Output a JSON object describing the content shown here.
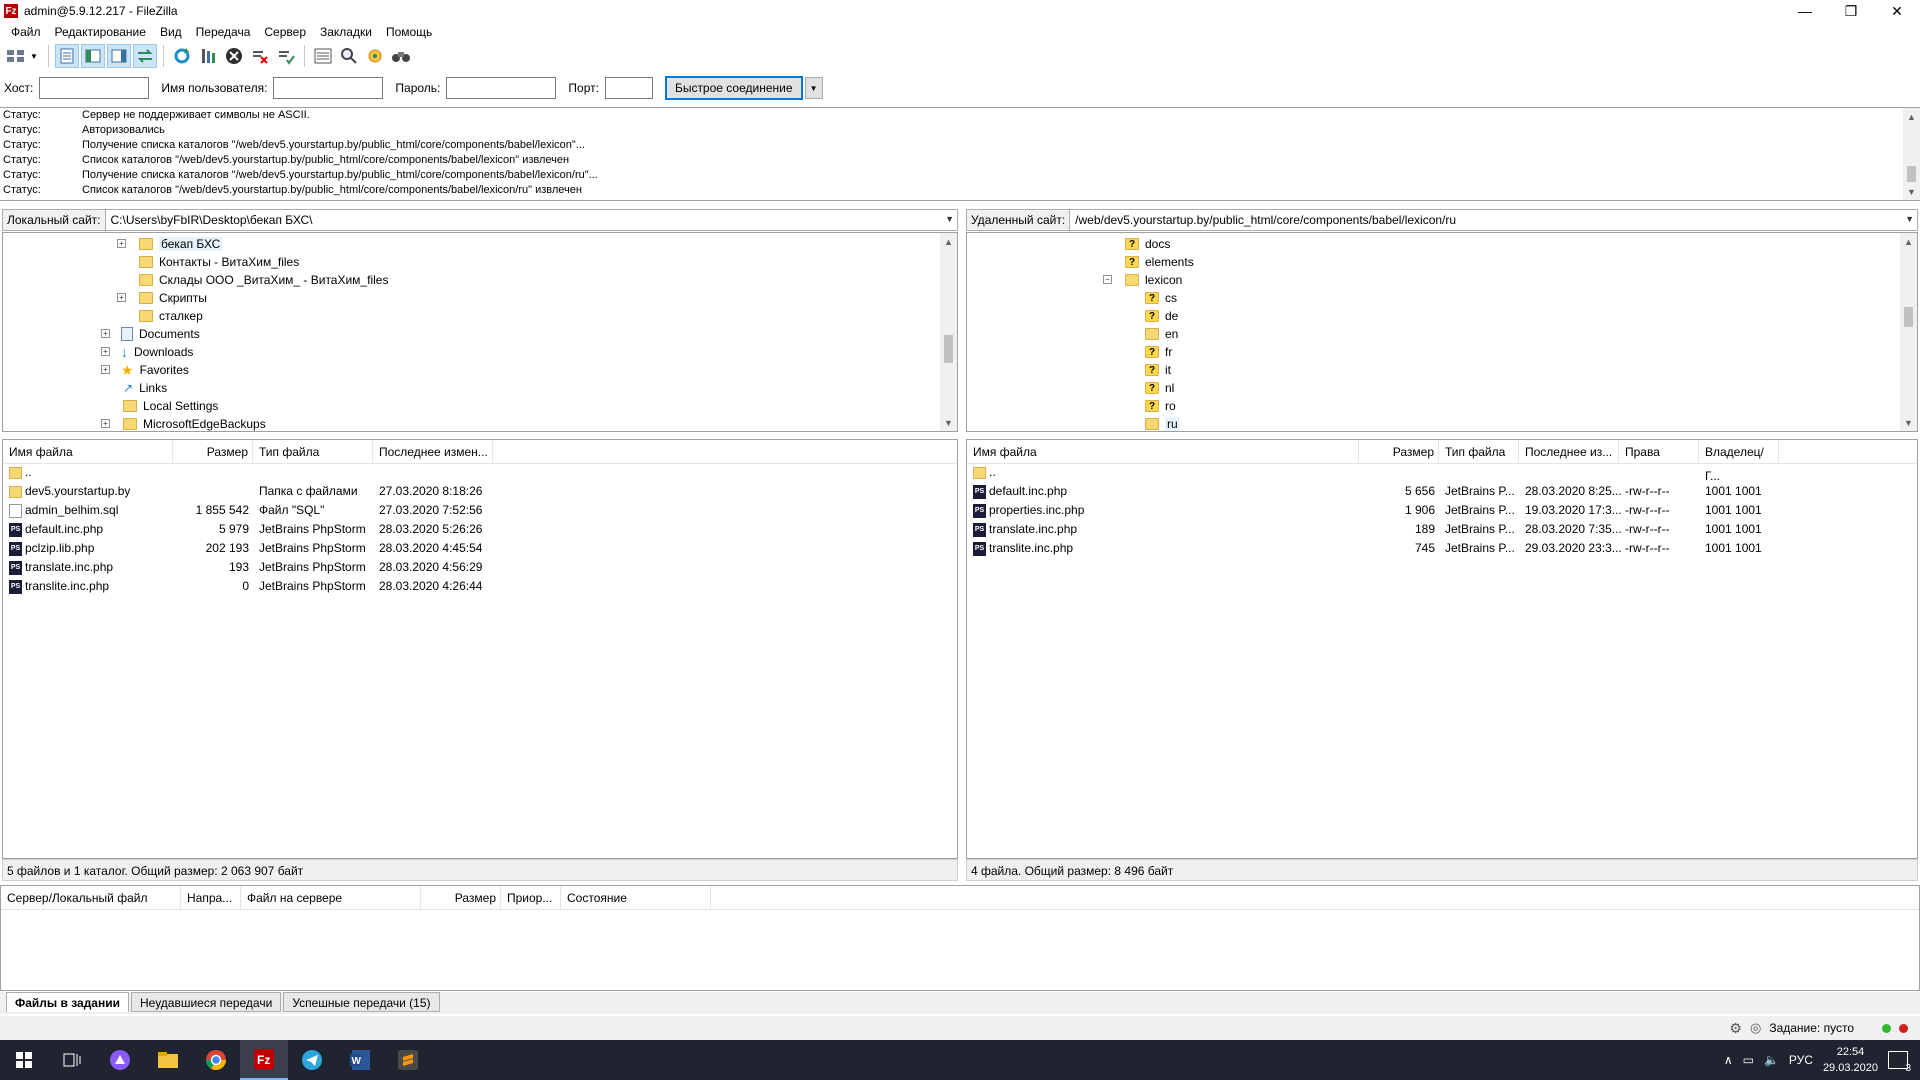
{
  "window": {
    "title": "admin@5.9.12.217 - FileZilla",
    "app_icon_letter": "Fz",
    "minimize": "—",
    "maximize": "❐",
    "close": "✕"
  },
  "menu": [
    "Файл",
    "Редактирование",
    "Вид",
    "Передача",
    "Сервер",
    "Закладки",
    "Помощь"
  ],
  "quickconnect": {
    "host_label": "Хост:",
    "host_value": "",
    "user_label": "Имя пользователя:",
    "user_value": "",
    "pass_label": "Пароль:",
    "pass_value": "",
    "port_label": "Порт:",
    "port_value": "",
    "connect_label": "Быстрое соединение"
  },
  "log": [
    {
      "status": "Статус:",
      "text": "Сервер не поддерживает символы не ASCII."
    },
    {
      "status": "Статус:",
      "text": "Авторизовались"
    },
    {
      "status": "Статус:",
      "text": "Получение списка каталогов \"/web/dev5.yourstartup.by/public_html/core/components/babel/lexicon\"..."
    },
    {
      "status": "Статус:",
      "text": "Список каталогов \"/web/dev5.yourstartup.by/public_html/core/components/babel/lexicon\" извлечен"
    },
    {
      "status": "Статус:",
      "text": "Получение списка каталогов \"/web/dev5.yourstartup.by/public_html/core/components/babel/lexicon/ru\"..."
    },
    {
      "status": "Статус:",
      "text": "Список каталогов \"/web/dev5.yourstartup.by/public_html/core/components/babel/lexicon/ru\" извлечен"
    }
  ],
  "local": {
    "site_label": "Локальный сайт:",
    "path": "C:\\Users\\byFbIR\\Desktop\\бекап БХС\\",
    "tree": [
      {
        "label": "бекап БХС",
        "exp": "+",
        "selected": true
      },
      {
        "label": "Контакты - ВитаХим_files",
        "exp": ""
      },
      {
        "label": "Склады ООО _ВитаХим_ - ВитаХим_files",
        "exp": ""
      },
      {
        "label": "Скрипты",
        "exp": "+"
      },
      {
        "label": "сталкер",
        "exp": ""
      },
      {
        "label": "Documents",
        "exp": "+"
      },
      {
        "label": "Downloads",
        "exp": "+"
      },
      {
        "label": "Favorites",
        "exp": "+"
      },
      {
        "label": "Links",
        "exp": ""
      },
      {
        "label": "Local Settings",
        "exp": ""
      },
      {
        "label": "MicrosoftEdgeBackups",
        "exp": "+"
      }
    ],
    "columns": [
      "Имя файла",
      "Размер",
      "Тип файла",
      "Последнее измен..."
    ],
    "files": [
      {
        "name": "..",
        "size": "",
        "type": "",
        "modified": "",
        "icon": "folder"
      },
      {
        "name": "dev5.yourstartup.by",
        "size": "",
        "type": "Папка с файлами",
        "modified": "27.03.2020 8:18:26",
        "icon": "folder"
      },
      {
        "name": "admin_belhim.sql",
        "size": "1 855 542",
        "type": "Файл \"SQL\"",
        "modified": "27.03.2020 7:52:56",
        "icon": "doc"
      },
      {
        "name": "default.inc.php",
        "size": "5 979",
        "type": "JetBrains PhpStorm",
        "modified": "28.03.2020 5:26:26",
        "icon": "ps"
      },
      {
        "name": "pclzip.lib.php",
        "size": "202 193",
        "type": "JetBrains PhpStorm",
        "modified": "28.03.2020 4:45:54",
        "icon": "ps"
      },
      {
        "name": "translate.inc.php",
        "size": "193",
        "type": "JetBrains PhpStorm",
        "modified": "28.03.2020 4:56:29",
        "icon": "ps"
      },
      {
        "name": "translite.inc.php",
        "size": "0",
        "type": "JetBrains PhpStorm",
        "modified": "28.03.2020 4:26:44",
        "icon": "ps"
      }
    ],
    "summary": "5 файлов и 1 каталог. Общий размер: 2 063 907 байт"
  },
  "remote": {
    "site_label": "Удаленный сайт:",
    "path": "/web/dev5.yourstartup.by/public_html/core/components/babel/lexicon/ru",
    "tree": [
      {
        "label": "docs",
        "icon": "q",
        "level": 0,
        "exp": ""
      },
      {
        "label": "elements",
        "icon": "q",
        "level": 0,
        "exp": ""
      },
      {
        "label": "lexicon",
        "icon": "folder",
        "level": 0,
        "exp": "−"
      },
      {
        "label": "cs",
        "icon": "q",
        "level": 1,
        "exp": ""
      },
      {
        "label": "de",
        "icon": "q",
        "level": 1,
        "exp": ""
      },
      {
        "label": "en",
        "icon": "folder",
        "level": 1,
        "exp": ""
      },
      {
        "label": "fr",
        "icon": "q",
        "level": 1,
        "exp": ""
      },
      {
        "label": "it",
        "icon": "q",
        "level": 1,
        "exp": ""
      },
      {
        "label": "nl",
        "icon": "q",
        "level": 1,
        "exp": ""
      },
      {
        "label": "ro",
        "icon": "q",
        "level": 1,
        "exp": ""
      },
      {
        "label": "ru",
        "icon": "folder",
        "level": 1,
        "exp": "",
        "selected": true
      }
    ],
    "columns": [
      "Имя файла",
      "Размер",
      "Тип файла",
      "Последнее из...",
      "Права",
      "Владелец/Г..."
    ],
    "files": [
      {
        "name": "..",
        "size": "",
        "type": "",
        "modified": "",
        "perms": "",
        "owner": "",
        "icon": "folder"
      },
      {
        "name": "default.inc.php",
        "size": "5 656",
        "type": "JetBrains P...",
        "modified": "28.03.2020 8:25...",
        "perms": "-rw-r--r--",
        "owner": "1001 1001",
        "icon": "ps"
      },
      {
        "name": "properties.inc.php",
        "size": "1 906",
        "type": "JetBrains P...",
        "modified": "19.03.2020 17:3...",
        "perms": "-rw-r--r--",
        "owner": "1001 1001",
        "icon": "ps"
      },
      {
        "name": "translate.inc.php",
        "size": "189",
        "type": "JetBrains P...",
        "modified": "28.03.2020 7:35...",
        "perms": "-rw-r--r--",
        "owner": "1001 1001",
        "icon": "ps"
      },
      {
        "name": "translite.inc.php",
        "size": "745",
        "type": "JetBrains P...",
        "modified": "29.03.2020 23:3...",
        "perms": "-rw-r--r--",
        "owner": "1001 1001",
        "icon": "ps"
      }
    ],
    "summary": "4 файла. Общий размер: 8 496 байт"
  },
  "queue": {
    "columns": [
      "Сервер/Локальный файл",
      "Напра...",
      "Файл на сервере",
      "Размер",
      "Приор...",
      "Состояние"
    ]
  },
  "tabs": [
    {
      "label": "Файлы в задании",
      "active": true
    },
    {
      "label": "Неудавшиеся передачи",
      "active": false
    },
    {
      "label": "Успешные передачи (15)",
      "active": false
    }
  ],
  "app_status": {
    "queue_text": "Задание: пусто"
  },
  "taskbar": {
    "lang": "РУС",
    "time": "22:54",
    "date": "29.03.2020",
    "notifications": "3"
  },
  "colors": {
    "accent": "#0078d7",
    "taskbar": "#1f2430",
    "folder": "#f8d775"
  }
}
